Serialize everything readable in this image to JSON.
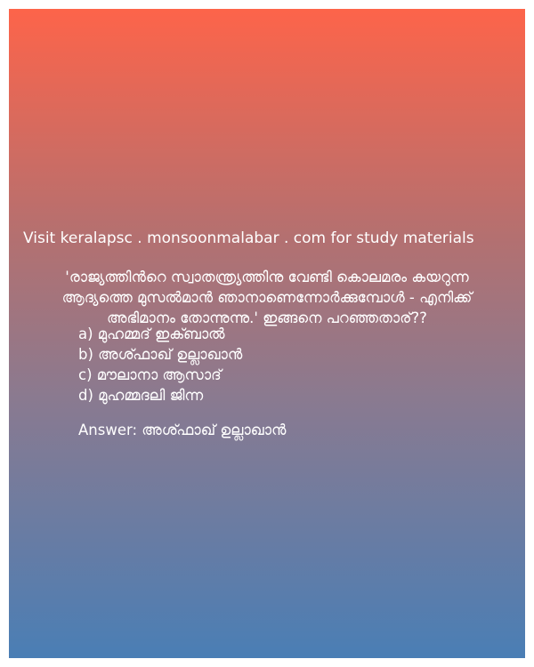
{
  "promo_text": "Visit keralapsc . monsoonmalabar . com for study materials",
  "question": {
    "line1": "'രാജ്യത്തിൻറെ സ്വാതന്ത്ര്യത്തിനു വേണ്ടി കൊലമരം കയറുന്ന",
    "line2": "ആദ്യത്തെ മുസൽമാൻ ഞാനാണെന്നോർക്കുമ്പോൾ - എനിക്ക്",
    "line3": "അഭിമാനം തോന്നുന്നു.' ഇങ്ങനെ പറഞ്ഞതാര്??"
  },
  "options": [
    "a) മുഹമ്മദ് ഇക്ബാൽ",
    "b) അശ്ഫാഖ് ഉല്ലാഖാൻ",
    "c) മൗലാനാ ആസാദ്",
    "d) മുഹമ്മദലി ജിന്ന"
  ],
  "answer_text": "Answer: അശ്ഫാഖ് ഉല്ലാഖാൻ"
}
